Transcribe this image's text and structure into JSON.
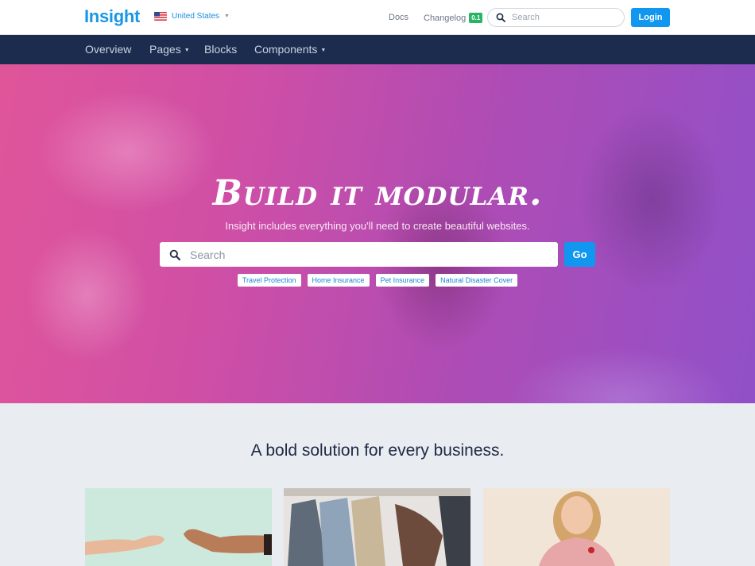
{
  "header": {
    "logo": "Insight",
    "country": "United States",
    "links": {
      "docs": "Docs",
      "changelog": "Changelog"
    },
    "changelog_badge": "0.1",
    "search_placeholder": "Search",
    "login_label": "Login"
  },
  "nav": {
    "items": [
      {
        "label": "Overview",
        "has_dropdown": false
      },
      {
        "label": "Pages",
        "has_dropdown": true
      },
      {
        "label": "Blocks",
        "has_dropdown": false
      },
      {
        "label": "Components",
        "has_dropdown": true
      }
    ]
  },
  "hero": {
    "title": "Build it modular.",
    "subtitle": "Insight includes everything you'll need to create beautiful websites.",
    "search_placeholder": "Search",
    "go_label": "Go",
    "tags": [
      "Travel Protection",
      "Home Insurance",
      "Pet Insurance",
      "Natural Disaster Cover"
    ]
  },
  "section": {
    "title": "A bold solution for every business."
  },
  "colors": {
    "brand": "#1997e6",
    "primary_button": "#1197f0",
    "nav_bg": "#1b2c4e",
    "badge_green": "#28b463"
  }
}
